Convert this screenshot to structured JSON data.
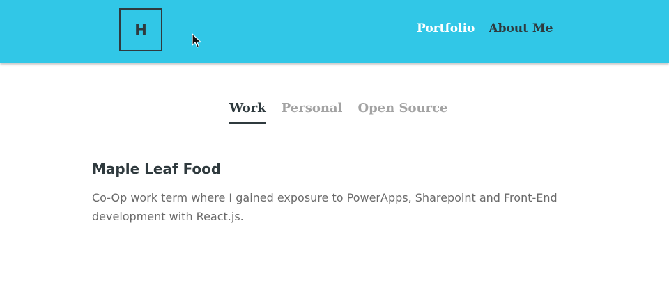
{
  "header": {
    "logo_letter": "H",
    "nav": {
      "portfolio": "Portfolio",
      "about": "About Me"
    },
    "colors": {
      "background": "#31c7e7",
      "active_nav": "#ffffff",
      "inactive_nav": "#2f3a3e"
    }
  },
  "tabs": {
    "work": "Work",
    "personal": "Personal",
    "open_source": "Open Source",
    "active": "Work"
  },
  "project": {
    "title": "Maple Leaf Food",
    "description": "Co-Op work term where I gained exposure to PowerApps, Sharepoint and Front-End development with React.js."
  },
  "icons": {
    "cursor": "mouse-pointer-icon"
  }
}
